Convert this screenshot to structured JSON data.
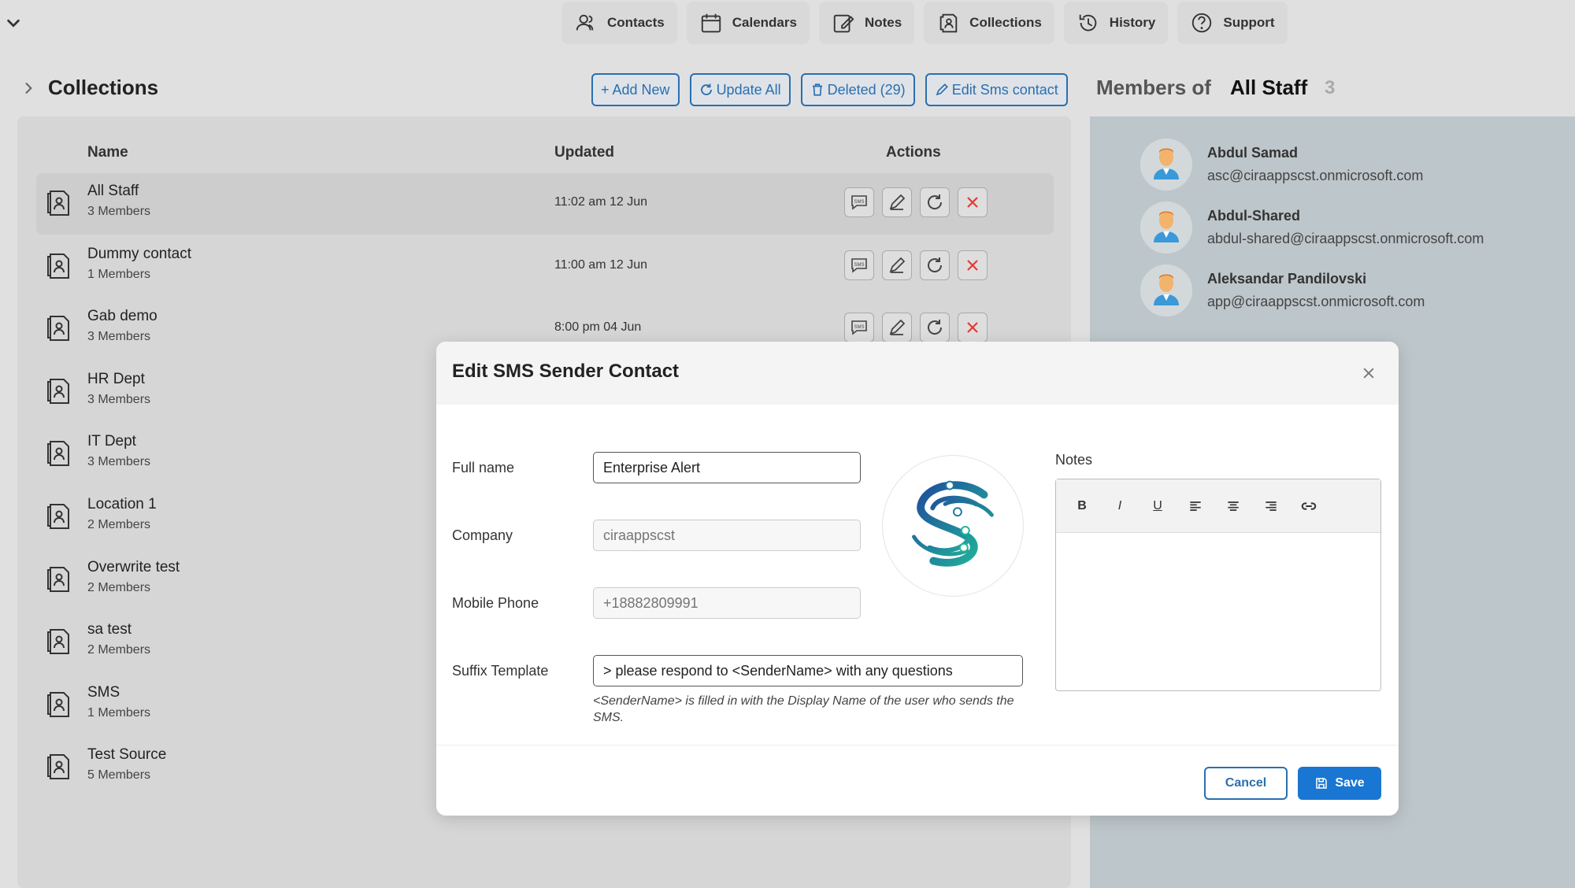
{
  "nav": {
    "items": [
      {
        "label": "Contacts",
        "icon": "contacts-icon"
      },
      {
        "label": "Calendars",
        "icon": "calendar-icon"
      },
      {
        "label": "Notes",
        "icon": "notes-icon"
      },
      {
        "label": "Collections",
        "icon": "collections-icon"
      },
      {
        "label": "History",
        "icon": "history-icon"
      },
      {
        "label": "Support",
        "icon": "help-icon"
      }
    ]
  },
  "header": {
    "title": "Collections",
    "add_new": "+ Add New",
    "update_all": "Update All",
    "deleted": "Deleted (29)",
    "edit_sms": "Edit Sms contact"
  },
  "members_panel": {
    "title": "Members of",
    "group": "All Staff",
    "count": "3",
    "members": [
      {
        "name": "Abdul Samad",
        "email": "asc@ciraappscst.onmicrosoft.com"
      },
      {
        "name": "Abdul-Shared",
        "email": "abdul-shared@ciraappscst.onmicrosoft.com"
      },
      {
        "name": "Aleksandar Pandilovski",
        "email": "app@ciraappscst.onmicrosoft.com"
      }
    ]
  },
  "table": {
    "columns": {
      "name": "Name",
      "updated": "Updated",
      "actions": "Actions"
    },
    "rows": [
      {
        "name": "All Staff",
        "members": "3 Members",
        "updated": "11:02 am 12 Jun"
      },
      {
        "name": "Dummy contact",
        "members": "1 Members",
        "updated": "11:00 am 12 Jun"
      },
      {
        "name": "Gab demo",
        "members": "3 Members",
        "updated": "8:00 pm 04 Jun"
      },
      {
        "name": "HR Dept",
        "members": "3 Members",
        "updated": ""
      },
      {
        "name": "IT Dept",
        "members": "3 Members",
        "updated": ""
      },
      {
        "name": "Location 1",
        "members": "2 Members",
        "updated": ""
      },
      {
        "name": "Overwrite test",
        "members": "2 Members",
        "updated": ""
      },
      {
        "name": "sa test",
        "members": "2 Members",
        "updated": ""
      },
      {
        "name": "SMS",
        "members": "1 Members",
        "updated": ""
      },
      {
        "name": "Test Source",
        "members": "5 Members",
        "updated": ""
      }
    ]
  },
  "modal": {
    "title": "Edit SMS Sender Contact",
    "full_name_label": "Full name",
    "full_name_value": "Enterprise Alert",
    "company_label": "Company",
    "company_placeholder": "ciraappscst",
    "mobile_label": "Mobile Phone",
    "mobile_placeholder": "+18882809991",
    "suffix_label": "Suffix Template",
    "suffix_value": "> please respond to <SenderName> with any questions",
    "suffix_hint": "<SenderName> is filled in with the Display Name of the user who sends the SMS.",
    "notes_label": "Notes",
    "notes_tools": {
      "bold": "B",
      "italic": "I",
      "underline": "U"
    },
    "cancel": "Cancel",
    "save": "Save"
  },
  "colors": {
    "accent": "#1976d2",
    "outline": "#2a6fb0",
    "danger": "#e53935"
  }
}
